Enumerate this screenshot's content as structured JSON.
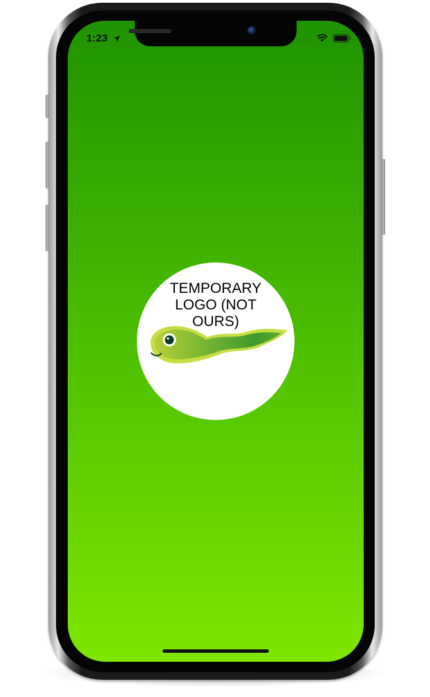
{
  "status_bar": {
    "time": "1:23",
    "icons": [
      "location-arrow-icon",
      "signal-dots-icon",
      "wifi-icon",
      "battery-icon"
    ]
  },
  "splash": {
    "logo_text": "TEMPORARY LOGO (NOT OURS)",
    "mascot": "green-tadpole-illustration"
  },
  "colors": {
    "gradient_top": "#1f9300",
    "gradient_bottom": "#7ee600",
    "logo_background": "#ffffff",
    "mascot_green": "#4fa82a",
    "mascot_yellow": "#c3d93a"
  }
}
